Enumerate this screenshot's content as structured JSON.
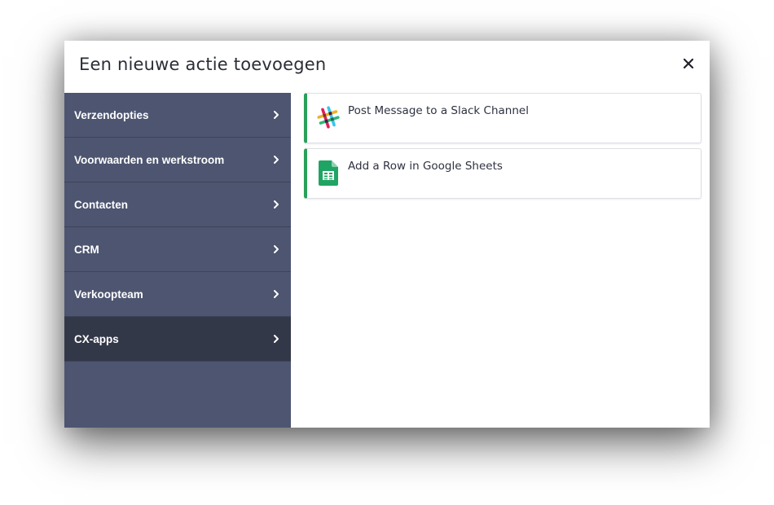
{
  "modal": {
    "title": "Een nieuwe actie toevoegen",
    "close_icon": "close-icon"
  },
  "sidebar": {
    "items": [
      {
        "label": "Verzendopties",
        "icon": "chevron-right-icon",
        "active": false
      },
      {
        "label": "Voorwaarden en werkstroom",
        "icon": "chevron-right-icon",
        "active": false
      },
      {
        "label": "Contacten",
        "icon": "chevron-right-icon",
        "active": false
      },
      {
        "label": "CRM",
        "icon": "chevron-right-icon",
        "active": false
      },
      {
        "label": "Verkoopteam",
        "icon": "chevron-right-icon",
        "active": false
      },
      {
        "label": "CX-apps",
        "icon": "chevron-right-icon",
        "active": true
      }
    ]
  },
  "actions": [
    {
      "label": "Post Message to a Slack Channel",
      "icon": "slack-icon"
    },
    {
      "label": "Add a Row in Google Sheets",
      "icon": "google-sheets-icon"
    }
  ],
  "colors": {
    "sidebar_bg": "#4d5570",
    "sidebar_active_bg": "#333849",
    "card_accent": "#2aa05b"
  }
}
